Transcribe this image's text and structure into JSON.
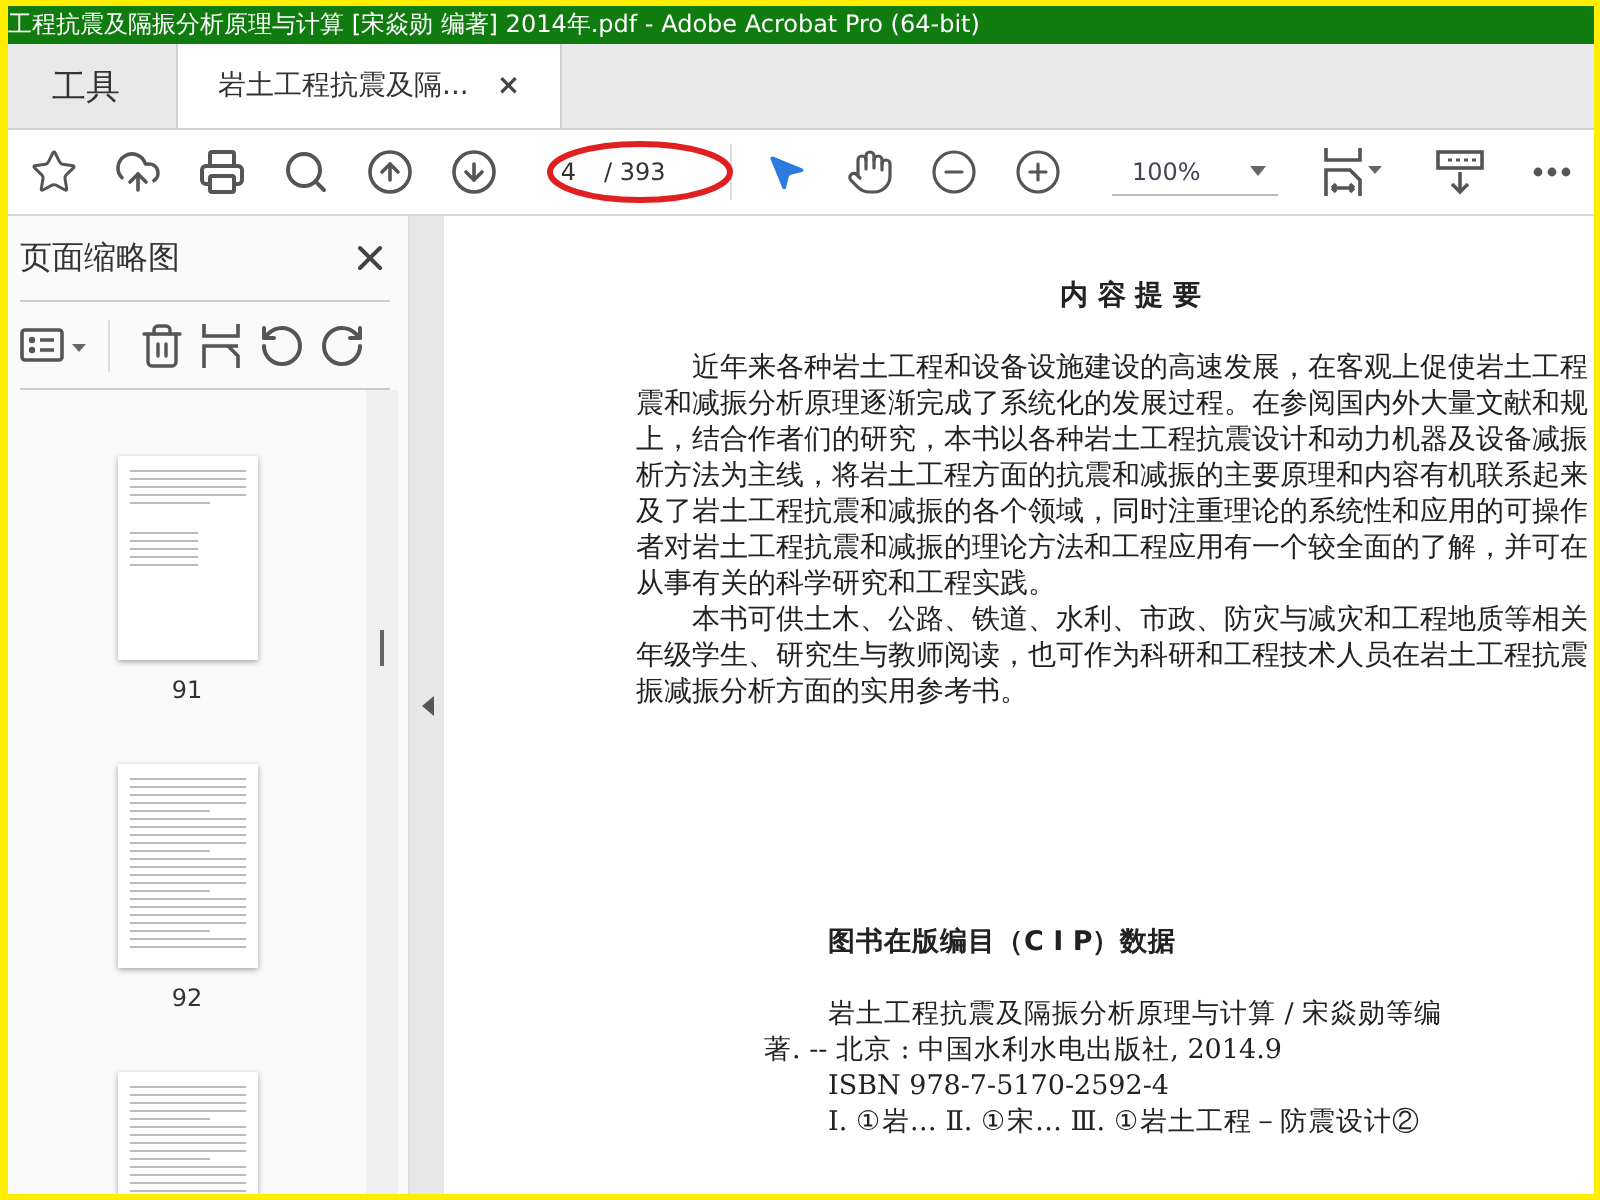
{
  "window": {
    "title": "工程抗震及隔振分析原理与计算 [宋焱勋 编著] 2014年.pdf - Adobe Acrobat Pro (64-bit)"
  },
  "tabs": [
    {
      "kind": "home",
      "label": "工具",
      "selected": false
    },
    {
      "kind": "document",
      "label": "岩土工程抗震及隔...",
      "selected": true,
      "close": "×"
    }
  ],
  "toolbar": {
    "page_field": {
      "value": "4",
      "total": "/ 393"
    },
    "zoom": {
      "value": "100%"
    }
  },
  "sidebar": {
    "title": "页面缩略图",
    "thumbnails": [
      {
        "label": "91",
        "kind": "figure"
      },
      {
        "label": "92",
        "kind": "text"
      },
      {
        "kind": "mixed"
      }
    ]
  },
  "document": {
    "heading": "内 容 提 要",
    "paragraphs": [
      {
        "lines": [
          "近年来各种岩土工程和设备设施建设的高速发展，在客观上促使岩土工程",
          "震和减振分析原理逐渐完成了系统化的发展过程。在参阅国内外大量文献和规",
          "上，结合作者们的研究，本书以各种岩土工程抗震设计和动力机器及设备减振",
          "析方法为主线，将岩土工程方面的抗震和减振的主要原理和内容有机联系起来",
          "及了岩土工程抗震和减振的各个领域，同时注重理论的系统性和应用的可操作",
          "者对岩土工程抗震和减振的理论方法和工程应用有一个较全面的了解，并可在",
          "从事有关的科学研究和工程实践。"
        ]
      },
      {
        "lines": [
          "本书可供土木、公路、铁道、水利、市政、防灾与减灾和工程地质等相关",
          "年级学生、研究生与教师阅读，也可作为科研和工程技术人员在岩土工程抗震",
          "振减振分析方面的实用参考书。"
        ]
      }
    ],
    "cip_heading": "图书在版编目（C I P）数据",
    "cip_lines": [
      {
        "kind": "indent",
        "text": "岩土工程抗震及隔振分析原理与计算 / 宋焱勋等编"
      },
      {
        "kind": "hanging",
        "text": "著. -- 北京 : 中国水利水电出版社, 2014.9"
      },
      {
        "kind": "indent",
        "text": "ISBN 978-7-5170-2592-4"
      },
      {
        "kind": "indent",
        "text": "Ⅰ. ①岩… Ⅱ. ①宋… Ⅲ. ①岩土工程－防震设计②"
      }
    ]
  }
}
